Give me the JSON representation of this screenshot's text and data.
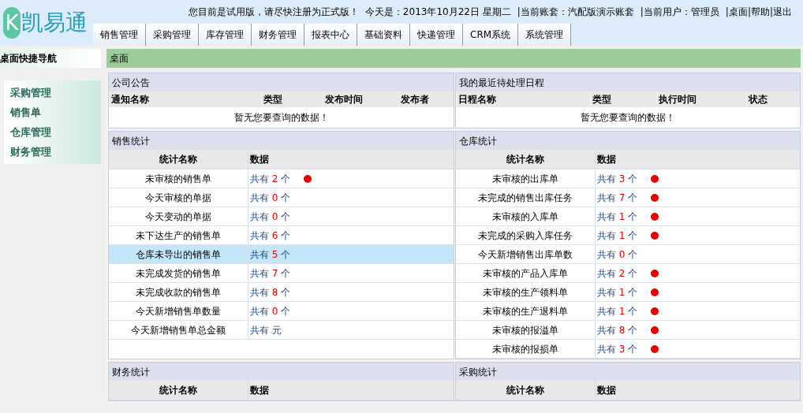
{
  "logo": {
    "letter": "K",
    "text": "凯易通"
  },
  "top_bar": {
    "notice": "您目前是试用版，请尽快注册为正式版！",
    "date": "今天是：2013年10月22日  星期二",
    "account": "|当前账套：汽配版演示账套",
    "user": "|当前用户：管理员",
    "links": [
      "|桌面",
      "|帮助",
      "|退出"
    ]
  },
  "menu": [
    "销售管理",
    "采购管理",
    "库存管理",
    "财务管理",
    "报表中心",
    "基础资料",
    "快递管理",
    "CRM系统",
    "系统管理"
  ],
  "sidebar": {
    "title": "桌面快捷导航",
    "items": [
      "采购管理",
      "销售单",
      "仓库管理",
      "财务管理"
    ]
  },
  "breadcrumb": "桌面",
  "announcements": {
    "title": "公司公告",
    "columns": [
      "通知名称",
      "类型",
      "发布时间",
      "发布者"
    ],
    "empty": "暂无您要查询的数据！"
  },
  "schedule": {
    "title": "我的最近待处理日程",
    "columns": [
      "日程名称",
      "类型",
      "执行时间",
      "状态"
    ],
    "empty": "暂无您要查询的数据！"
  },
  "sales_stats": {
    "title": "销售统计",
    "columns": [
      "统计名称",
      "数据"
    ],
    "rows": [
      {
        "name": "未审核的销售单",
        "prefix": "共有",
        "count": "2",
        "unit": "个",
        "alert": true,
        "selected": false
      },
      {
        "name": "今天审核的单据",
        "prefix": "共有",
        "count": "0",
        "unit": "个",
        "alert": false,
        "selected": false
      },
      {
        "name": "今天变动的单据",
        "prefix": "共有",
        "count": "0",
        "unit": "个",
        "alert": false,
        "selected": false
      },
      {
        "name": "未下达生产的销售单",
        "prefix": "共有",
        "count": "6",
        "unit": "个",
        "alert": false,
        "selected": false
      },
      {
        "name": "仓库未导出的销售单",
        "prefix": "共有",
        "count": "5",
        "unit": "个",
        "alert": false,
        "selected": true
      },
      {
        "name": "未完成发货的销售单",
        "prefix": "共有",
        "count": "7",
        "unit": "个",
        "alert": false,
        "selected": false
      },
      {
        "name": "未完成收款的销售单",
        "prefix": "共有",
        "count": "8",
        "unit": "个",
        "alert": false,
        "selected": false
      },
      {
        "name": "今天新增销售单数量",
        "prefix": "共有",
        "count": "0",
        "unit": "个",
        "alert": false,
        "selected": false
      },
      {
        "name": "今天新增销售单总金额",
        "prefix": "共有",
        "unit": "元",
        "alert": false,
        "selected": false
      }
    ]
  },
  "warehouse_stats": {
    "title": "仓库统计",
    "columns": [
      "统计名称",
      "数据"
    ],
    "rows": [
      {
        "name": "未审核的出库单",
        "prefix": "共有",
        "count": "3",
        "unit": "个",
        "alert": true,
        "selected": false
      },
      {
        "name": "未完成的销售出库任务",
        "prefix": "共有",
        "count": "7",
        "unit": "个",
        "alert": true,
        "selected": false
      },
      {
        "name": "未审核的入库单",
        "prefix": "共有",
        "count": "1",
        "unit": "个",
        "alert": true,
        "selected": false
      },
      {
        "name": "未完成的采购入库任务",
        "prefix": "共有",
        "count": "1",
        "unit": "个",
        "alert": true,
        "selected": false
      },
      {
        "name": "今天新增销售出库单数",
        "prefix": "共有",
        "count": "0",
        "unit": "个",
        "alert": false,
        "selected": false
      },
      {
        "name": "未审核的产品入库单",
        "prefix": "共有",
        "count": "2",
        "unit": "个",
        "alert": true,
        "selected": false
      },
      {
        "name": "未审核的生产领料单",
        "prefix": "共有",
        "count": "1",
        "unit": "个",
        "alert": true,
        "selected": false
      },
      {
        "name": "未审核的生产退料单",
        "prefix": "共有",
        "count": "1",
        "unit": "个",
        "alert": true,
        "selected": false
      },
      {
        "name": "未审核的报溢单",
        "prefix": "共有",
        "count": "8",
        "unit": "个",
        "alert": true,
        "selected": false
      },
      {
        "name": "未审核的报损单",
        "prefix": "共有",
        "count": "3",
        "unit": "个",
        "alert": true,
        "selected": false
      }
    ]
  },
  "finance_stats": {
    "title": "财务统计",
    "columns": [
      "统计名称",
      "数据"
    ]
  },
  "purchase_stats": {
    "title": "采购统计",
    "columns": [
      "统计名称",
      "数据"
    ]
  }
}
